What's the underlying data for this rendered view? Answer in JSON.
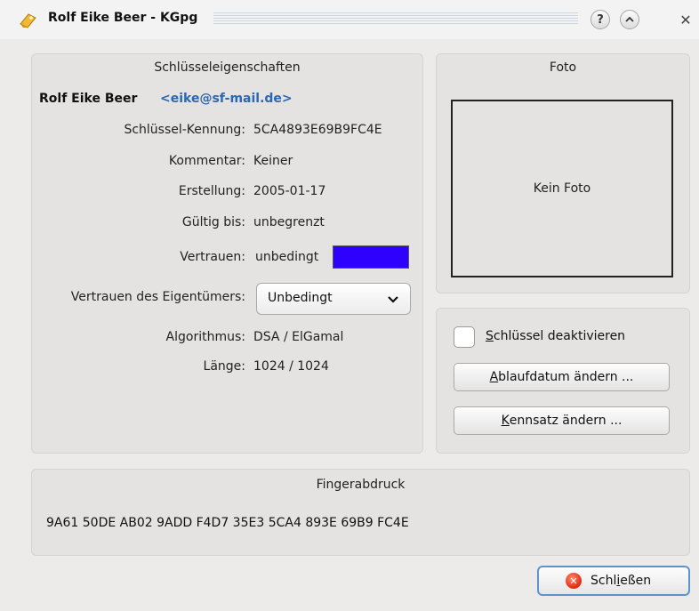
{
  "window": {
    "title": "Rolf Eike Beer - KGpg",
    "buttons": {
      "help": "?",
      "minimize": "^",
      "close": "✕"
    }
  },
  "key_properties": {
    "group_title": "Schlüsseleigenschaften",
    "owner_name": "Rolf Eike Beer",
    "owner_email": "<eike@sf-mail.de>",
    "fields": [
      {
        "label": "Schlüssel-Kennung:",
        "value": "5CA4893E69B9FC4E"
      },
      {
        "label": "Kommentar:",
        "value": "Keiner"
      },
      {
        "label": "Erstellung:",
        "value": "2005-01-17"
      },
      {
        "label": "Gültig bis:",
        "value": "unbegrenzt"
      },
      {
        "label": "Vertrauen:",
        "value": "unbedingt"
      }
    ],
    "trust_color": "#2d00ff",
    "owner_trust_label": "Vertrauen des Eigentümers:",
    "owner_trust_value": "Unbedingt",
    "algorithm_label": "Algorithmus:",
    "algorithm_value": "DSA / ElGamal",
    "length_label": "Länge:",
    "length_value": "1024 / 1024"
  },
  "photo": {
    "group_title": "Foto",
    "placeholder": "Kein Foto"
  },
  "actions": {
    "disable_key": {
      "accel": "S",
      "rest": "chlüssel deaktivieren",
      "checked": false
    },
    "change_expiry": {
      "accel": "A",
      "rest": "blaufdatum ändern ..."
    },
    "change_passphrase": {
      "accel": "K",
      "rest": "ennsatz ändern ..."
    }
  },
  "fingerprint": {
    "group_title": "Fingerabdruck",
    "value": "9A61 50DE AB02 9ADD F4D7 35E3 5CA4 893E 69B9 FC4E"
  },
  "footer": {
    "close_pre": "Schl",
    "close_accel": "i",
    "close_post": "eßen"
  }
}
